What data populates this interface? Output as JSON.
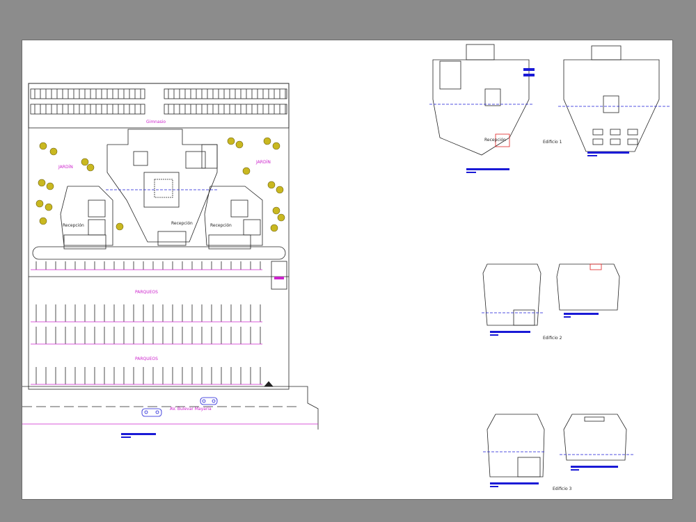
{
  "site_plan": {
    "labels": {
      "top_strip": "Gimnasio",
      "garden_left": "JARDÍN",
      "garden_right": "JARDÍN",
      "reception_center": "Recepción",
      "reception_left": "Recepción",
      "reception_right": "Recepción",
      "parking_upper": "PARQUEOS",
      "parking_lower": "PARQUEOS",
      "avenue": "AV. Bulevar Mayaría"
    }
  },
  "plans": {
    "edificio_1": {
      "caption": "Edificio 1",
      "reception": "Recepción"
    },
    "edificio_2": {
      "caption": "Edificio 2"
    },
    "edificio_3": {
      "caption": "Edificio 3"
    }
  },
  "colors": {
    "background": "#8c8c8c",
    "sheet": "#ffffff",
    "linework": "#222222",
    "annotation": "#cc22cc",
    "dimension": "#1a1ad6",
    "vegetation": "#c9b820",
    "accent_red": "#e02020"
  }
}
